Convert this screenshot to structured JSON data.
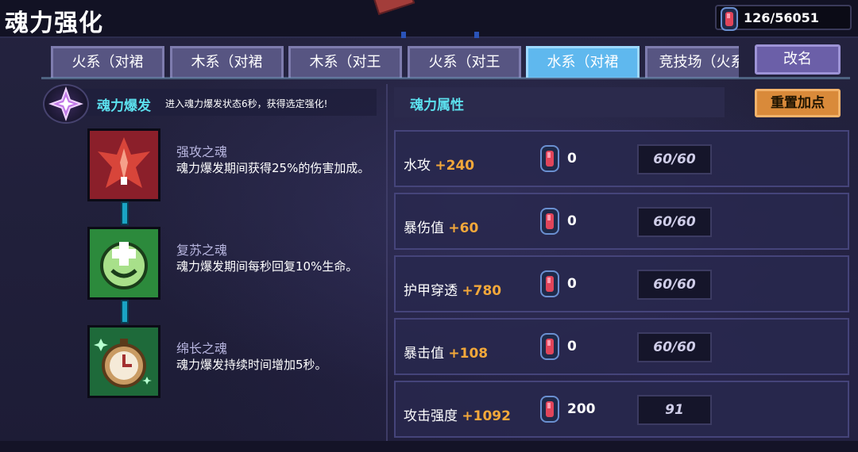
{
  "header": {
    "title": "魂力强化",
    "currency_value": "126/56051"
  },
  "tabs": [
    {
      "label": "火系（对裙",
      "active": false
    },
    {
      "label": "木系（对裙",
      "active": false
    },
    {
      "label": "木系（对王",
      "active": false
    },
    {
      "label": "火系（对王",
      "active": false
    },
    {
      "label": "水系（对裙",
      "active": true
    },
    {
      "label": "竞技场（火系",
      "active": false
    }
  ],
  "buttons": {
    "rename": "改名",
    "reset": "重置加点"
  },
  "burst": {
    "title": "魂力爆发",
    "description": "进入魂力爆发状态6秒，获得选定强化!"
  },
  "souls": [
    {
      "name": "强攻之魂",
      "desc": "魂力爆发期间获得25%的伤害加成。",
      "icon": "attack-soul-icon"
    },
    {
      "name": "复苏之魂",
      "desc": "魂力爆发期间每秒回复10%生命。",
      "icon": "revive-soul-icon"
    },
    {
      "name": "绵长之魂",
      "desc": "魂力爆发持续时间增加5秒。",
      "icon": "duration-soul-icon"
    }
  ],
  "attributes": {
    "title": "魂力属性",
    "rows": [
      {
        "label": "水攻",
        "bonus": "+240",
        "cost": "0",
        "level": "60/60"
      },
      {
        "label": "暴伤值",
        "bonus": "+60",
        "cost": "0",
        "level": "60/60"
      },
      {
        "label": "护甲穿透",
        "bonus": "+780",
        "cost": "0",
        "level": "60/60"
      },
      {
        "label": "暴击值",
        "bonus": "+108",
        "cost": "0",
        "level": "60/60"
      },
      {
        "label": "攻击强度",
        "bonus": "+1092",
        "cost": "200",
        "level": "91"
      }
    ]
  },
  "colors": {
    "accent_cyan": "#5ce0ee",
    "bonus_orange": "#f3a83a",
    "active_tab": "#5fb8ee",
    "reset_button": "#d98a3a"
  }
}
